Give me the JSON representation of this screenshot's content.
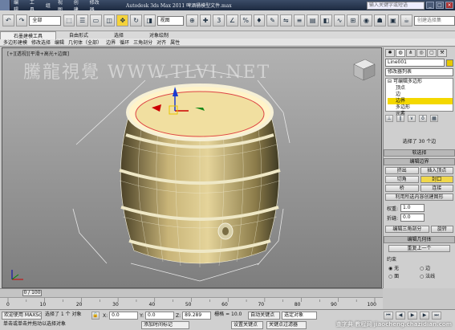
{
  "titlebar": {
    "title": "Autodesk 3ds Max  2011    啤酒桶模型文件.max",
    "search_placeholder": "输入关键字或短语",
    "menus": [
      "编辑",
      "工具",
      "组",
      "视图",
      "创建",
      "修改器",
      "动画",
      "图形编辑器",
      "渲染",
      "自定义",
      "MAXScript",
      "帮助"
    ]
  },
  "toolbar": {
    "selection_filter": "全部",
    "view_dropdown": "视图",
    "named_set_placeholder": "创建选择集"
  },
  "ribbon": {
    "tabs": [
      "石墨建模工具",
      "自由形式",
      "选择",
      "对象绘制"
    ],
    "active_tab": "石墨建模工具",
    "sub": [
      "多边形建模",
      "修改选择",
      "编辑",
      "几何体（全部）",
      "边界",
      "循环",
      "三角剖分",
      "对齐",
      "属性"
    ]
  },
  "viewport": {
    "label": "[+][透视][平滑+高光+边面]",
    "watermark": "騰龍視覺 WWW.TLVI.NET"
  },
  "panel": {
    "object_name": "Line001",
    "modifier_list": "修改器列表",
    "stack": [
      "可编辑多边形",
      "顶点",
      "边",
      "边界",
      "多边形",
      "元素"
    ],
    "active_stack_item": "边界",
    "selection_status": "选择了 30 个边",
    "rollouts": {
      "soft": "软选择",
      "edit_borders": "编辑边界",
      "edit_geometry": "编辑几何体"
    },
    "buttons": {
      "extrude": "挤出",
      "insert_vertex": "插入顶点",
      "chamfer": "切角",
      "cap": "封口",
      "bridge": "桥",
      "connect": "连接",
      "create_shape": "利用所选内容创建图形",
      "edit_tri": "编辑三角剖分",
      "turn": "旋转",
      "repeat_last": "重复上一个"
    },
    "weight_label": "权重:",
    "weight_value": "1.0",
    "crease_label": "折缝:",
    "crease_value": "0.0",
    "constraints_label": "约束",
    "constraints": [
      "无",
      "边",
      "面",
      "法线"
    ]
  },
  "timeslider": {
    "value": "0 / 100"
  },
  "track": {
    "ticks": [
      "0",
      "10",
      "20",
      "30",
      "40",
      "50",
      "60",
      "70",
      "80",
      "90",
      "100"
    ]
  },
  "status": {
    "selected": "选择了 1 个 对象",
    "hint": "单击或单击并拖动以选择对象",
    "welcome": "欢迎使用 MAXSc",
    "x_label": "X:",
    "x_value": "0.0",
    "y_label": "Y:",
    "y_value": "0.0",
    "z_label": "Z:",
    "z_value": "89.289",
    "grid": "栅格 = 10.0",
    "auto_key": "自动关键点",
    "set_key": "设置关键点",
    "key_mode": "选定对象",
    "key_filters": "关键点过滤器",
    "add_time_tag": "添加时间标记"
  },
  "site_watermark": "查字典 教程网 jiaocheng.chazidian.com",
  "colors": {
    "barrel_wood": "#c8b478",
    "barrel_top": "#f1dfa0",
    "bands": "#e8e2c0"
  }
}
